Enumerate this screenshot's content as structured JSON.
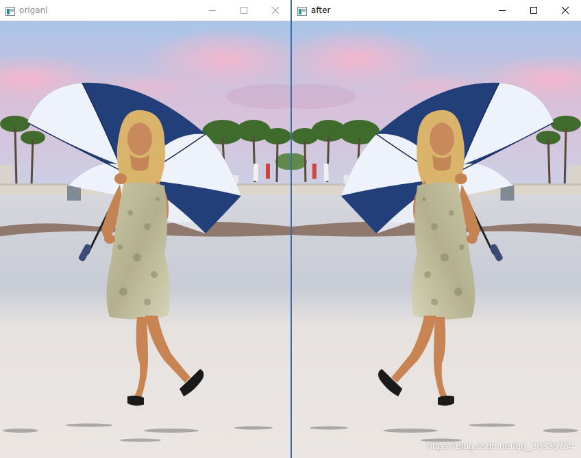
{
  "windows": {
    "left": {
      "title": "origanl"
    },
    "right": {
      "title": "after"
    }
  },
  "icons": {
    "app": "image-window-icon",
    "minimize": "minimize-icon",
    "maximize": "maximize-icon",
    "close": "close-icon"
  },
  "colors": {
    "sky_top": "#a8c4e8",
    "cloud_pink": "#f2b8cf",
    "umbrella_navy": "#223f7a",
    "umbrella_white": "#eef2fb",
    "sand": "#e8e4e1",
    "divider": "#3a6ea5"
  },
  "watermark": "https://blog.csdn.net/qq_36338754"
}
